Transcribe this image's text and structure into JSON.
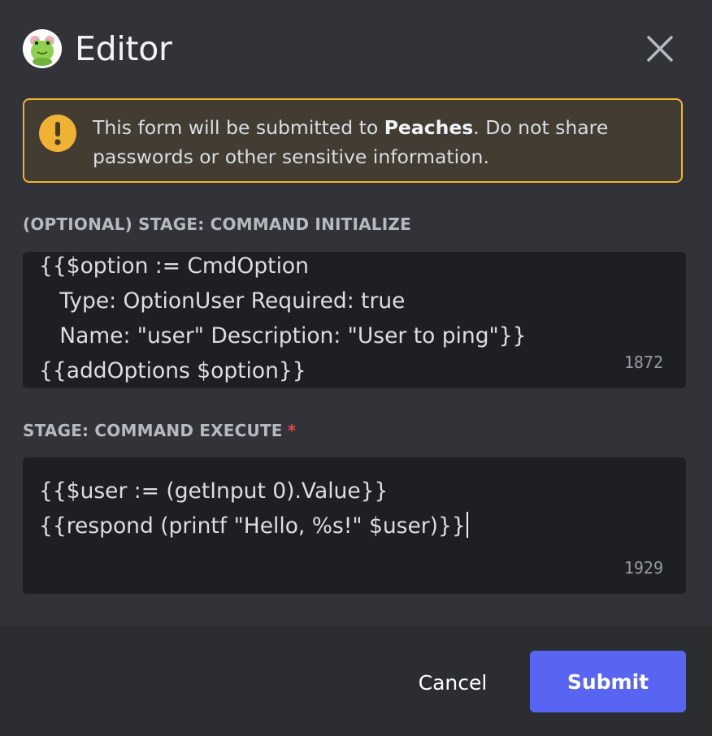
{
  "modal": {
    "title": "Editor",
    "avatar_icon": "frog-avatar-icon",
    "close_icon": "close-icon"
  },
  "warning": {
    "icon": "exclamation-icon",
    "text_before": "This form will be submitted to ",
    "app_name": "Peaches",
    "text_after": ". Do not share passwords or other sensitive information.",
    "color": "#f0b232"
  },
  "fields": [
    {
      "label": "(OPTIONAL) STAGE: COMMAND INITIALIZE",
      "required": false,
      "value_lines": [
        "{{$option := CmdOption",
        "   Type: OptionUser Required: true",
        "   Name: \"user\" Description: \"User to ping\"}}",
        "{{addOptions $option}}"
      ],
      "remaining_chars": "1872"
    },
    {
      "label": "STAGE: COMMAND EXECUTE",
      "required": true,
      "required_mark": "*",
      "value_lines": [
        "{{$user := (getInput 0).Value}}",
        "{{respond (printf \"Hello, %s!\" $user)}}"
      ],
      "remaining_chars": "1929"
    }
  ],
  "footer": {
    "cancel_label": "Cancel",
    "submit_label": "Submit",
    "submit_color": "#5865f2"
  }
}
